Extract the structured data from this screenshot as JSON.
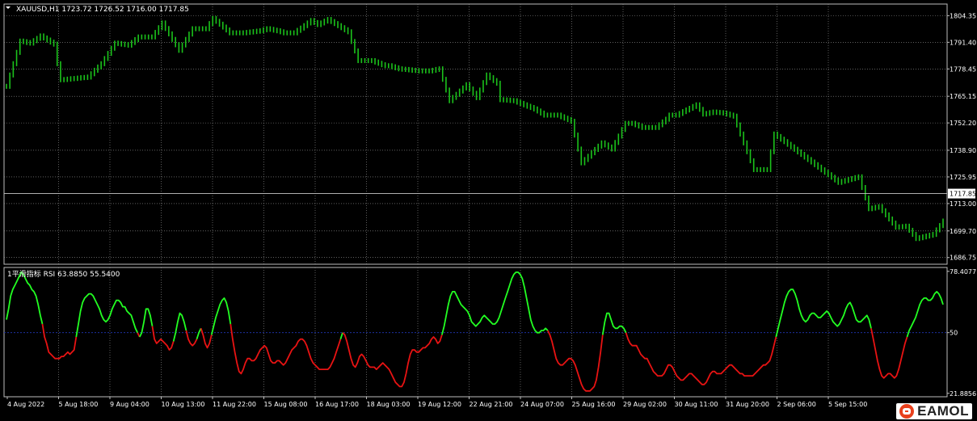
{
  "colors": {
    "background": "#000000",
    "grid": "#9a9a9a",
    "price_bars": "#1bc21b",
    "rsi_up": "#22ff22",
    "rsi_down": "#e81313",
    "rsi_level": "#1c2f9e",
    "current_price_line": "#c8c8c8",
    "text": "#ffffff"
  },
  "chart_data": [
    {
      "type": "candlestick",
      "title": "XAUUSD,H1  1723.72 1726.52 1716.00 1717.85",
      "y_axis_ticks": [
        "1804.35",
        "1791.40",
        "1778.45",
        "1765.15",
        "1752.20",
        "1738.90",
        "1725.95",
        "1713.00",
        "1699.70",
        "1686.75"
      ],
      "ylim": [
        1683.5,
        1810
      ],
      "current_price": 1717.85,
      "current_price_label": "1717.85",
      "grid": true,
      "x": [
        0,
        1,
        2,
        3,
        4,
        5,
        6,
        7,
        8,
        9,
        10,
        11,
        12,
        13,
        14,
        15,
        16,
        17,
        18,
        19,
        20,
        21,
        22,
        23,
        24,
        25,
        26,
        27,
        28,
        29,
        30,
        31,
        32,
        33,
        34,
        35,
        36,
        37,
        38,
        39,
        40,
        41,
        42,
        43,
        44,
        45,
        46,
        47,
        48,
        49,
        50,
        51,
        52,
        53,
        54,
        55,
        56,
        57,
        58,
        59,
        60,
        61,
        62,
        63,
        64,
        65,
        66,
        67,
        68,
        69,
        70,
        71,
        72,
        73,
        74,
        75,
        76,
        77,
        78,
        79,
        80,
        81,
        82,
        83,
        84,
        85,
        86,
        87,
        88,
        89,
        90,
        91,
        92,
        93,
        94,
        95,
        96,
        97,
        98,
        99,
        100,
        101,
        102,
        103,
        104,
        105,
        106,
        107,
        108,
        109,
        110,
        111,
        112,
        113,
        114,
        115,
        116,
        117,
        118,
        119,
        120,
        121,
        122,
        123,
        124,
        125,
        126,
        127,
        128,
        129,
        130,
        131,
        132,
        133,
        134,
        135,
        136,
        137,
        138,
        139,
        140,
        141,
        142,
        143,
        144,
        145,
        146,
        147,
        148,
        149,
        150,
        151,
        152,
        153,
        154,
        155,
        156,
        157,
        158,
        159,
        160,
        161,
        162,
        163,
        164,
        165,
        166,
        167,
        168,
        169,
        170,
        171,
        172,
        173,
        174,
        175,
        176,
        177,
        178,
        179,
        180,
        181,
        182,
        183,
        184,
        185,
        186,
        187,
        188,
        189,
        190,
        191,
        192,
        193,
        194,
        195,
        196,
        197,
        198,
        199,
        200,
        201,
        202,
        203,
        204,
        205,
        206,
        207,
        208,
        209,
        210,
        211,
        212,
        213,
        214,
        215,
        216,
        217,
        218,
        219,
        220,
        221,
        222,
        223,
        224,
        225,
        226,
        227,
        228,
        229,
        230,
        231,
        232,
        233,
        234,
        235,
        236,
        237,
        238,
        239,
        240,
        241,
        242,
        243,
        244,
        245,
        246,
        247,
        248,
        249,
        250,
        251,
        252,
        253,
        254,
        255,
        256,
        257,
        258,
        259,
        260,
        261,
        262,
        263,
        264,
        265,
        266,
        267,
        268,
        269,
        270,
        271,
        272,
        273,
        274,
        275,
        276,
        277,
        278,
        279,
        280,
        281,
        282,
        283,
        284,
        285,
        286,
        287,
        288,
        289,
        290
      ],
      "close": [
        1770,
        1775.5,
        1781,
        1786.5,
        1792,
        1791.7,
        1791.3,
        1791,
        1792.2,
        1793.3,
        1794.5,
        1793.5,
        1792.5,
        1791.5,
        1790.5,
        1781,
        1773.2,
        1773.3,
        1773.5,
        1773.7,
        1773.8,
        1774,
        1774.2,
        1774.3,
        1774.5,
        1776.1,
        1777.8,
        1779.4,
        1781,
        1783.5,
        1786,
        1788.5,
        1791,
        1790.8,
        1790.5,
        1790.3,
        1790,
        1791.3,
        1792.7,
        1794,
        1794,
        1794,
        1794,
        1794,
        1796.2,
        1798.5,
        1800.8,
        1798.1,
        1795.5,
        1792.8,
        1790.2,
        1787.5,
        1790.1,
        1792.8,
        1795.4,
        1798,
        1798,
        1798,
        1798,
        1798,
        1800.5,
        1803,
        1801.6,
        1800.2,
        1798.8,
        1797.4,
        1796,
        1796,
        1796,
        1796,
        1796,
        1796.2,
        1796.4,
        1796.6,
        1796.8,
        1797,
        1797.5,
        1798,
        1797.7,
        1797.3,
        1797,
        1796.5,
        1796,
        1796,
        1796,
        1796,
        1797.2,
        1798.3,
        1799.5,
        1800.8,
        1802,
        1801,
        1800,
        1800.8,
        1801.7,
        1802.5,
        1801.5,
        1800.5,
        1799.5,
        1798.5,
        1797.5,
        1796.5,
        1791.8,
        1787.2,
        1782.5,
        1782.5,
        1782.5,
        1782.5,
        1782.5,
        1781.8,
        1781.2,
        1780.5,
        1780,
        1780,
        1779.5,
        1779,
        1778.5,
        1778.3,
        1778.2,
        1778,
        1777.8,
        1777.7,
        1777.5,
        1777.5,
        1777.5,
        1777.5,
        1777.8,
        1778.2,
        1778.5,
        1773.4,
        1768.2,
        1763,
        1764.6,
        1766.1,
        1767.7,
        1769.2,
        1770.8,
        1768.7,
        1766.6,
        1764.5,
        1768.2,
        1771.8,
        1775.5,
        1774.2,
        1772.8,
        1771.5,
        1763.5,
        1763.4,
        1763.3,
        1763.1,
        1763,
        1762.3,
        1761.7,
        1761,
        1760.3,
        1759.7,
        1759,
        1758,
        1757,
        1756,
        1756,
        1756,
        1756,
        1756,
        1755.2,
        1754.5,
        1753.8,
        1753,
        1746.3,
        1739.5,
        1732.8,
        1734.4,
        1736,
        1737.7,
        1739.3,
        1740.9,
        1742.5,
        1741.5,
        1740.5,
        1739.5,
        1742.7,
        1745.8,
        1749,
        1752,
        1752,
        1752,
        1751.3,
        1750.7,
        1750,
        1750,
        1750,
        1750,
        1750,
        1751.3,
        1752.7,
        1754,
        1756,
        1756,
        1756,
        1756.8,
        1757.7,
        1758.5,
        1759.3,
        1760.2,
        1761,
        1758.8,
        1756.5,
        1756.8,
        1757.2,
        1757.5,
        1757.3,
        1757.2,
        1757,
        1756.5,
        1756,
        1755.5,
        1751.2,
        1746.8,
        1742.5,
        1738.2,
        1733.8,
        1729.5,
        1729.5,
        1729.5,
        1729.5,
        1729.5,
        1738.2,
        1746.8,
        1745.6,
        1744.3,
        1743.1,
        1741.8,
        1740.6,
        1739.4,
        1738.1,
        1736.9,
        1735.6,
        1734.4,
        1733.2,
        1731.9,
        1730.7,
        1729.4,
        1728.2,
        1727,
        1725.8,
        1724.5,
        1723.3,
        1723.8,
        1724.2,
        1724.7,
        1725.1,
        1725.6,
        1726,
        1720.8,
        1715.7,
        1710.5,
        1710.8,
        1711.2,
        1711.5,
        1709.5,
        1707.5,
        1705.5,
        1703.5,
        1701.5,
        1701.7,
        1701.8,
        1702,
        1700,
        1698,
        1696,
        1696.4,
        1696.8,
        1697.2,
        1697.6,
        1698,
        1700.2,
        1702.3,
        1704.5
      ],
      "x_axis_ticks": [
        "4 Aug 2022",
        "5 Aug 18:00",
        "9 Aug 04:00",
        "10 Aug 13:00",
        "11 Aug 22:00",
        "15 Aug 08:00",
        "16 Aug 17:00",
        "18 Aug 03:00",
        "19 Aug 12:00",
        "22 Aug 21:00",
        "24 Aug 07:00",
        "25 Aug 16:00",
        "29 Aug 02:00",
        "30 Aug 11:00",
        "31 Aug 20:00",
        "2 Sep 06:00",
        "5 Sep 15:00"
      ],
      "note": "close-only approximation of hourly bars; last bar close 1717.85"
    },
    {
      "type": "line",
      "title": "1平滑指标 RSI 63.8850 55.5400",
      "y_axis_ticks": [
        "78.4077",
        "50",
        "21.8856"
      ],
      "ylim": [
        20.3,
        80.2
      ],
      "level": 50,
      "grid": true,
      "series": [
        {
          "values": [
            56,
            61,
            67,
            70,
            72,
            74,
            76,
            78,
            77,
            75,
            73,
            72,
            70,
            69,
            67,
            63,
            58,
            54,
            48,
            45,
            41,
            40,
            39,
            38,
            38,
            38,
            39,
            39,
            40,
            41,
            40,
            41,
            42,
            48,
            54,
            60,
            64,
            66,
            67,
            68,
            68,
            67,
            65,
            63,
            61,
            58,
            56,
            55,
            56,
            58,
            61,
            63,
            65,
            65,
            64,
            62,
            62,
            60,
            59,
            58,
            55,
            52,
            50,
            48,
            50,
            55,
            61,
            61,
            58,
            53,
            47,
            45,
            46,
            47,
            46,
            45,
            44,
            42,
            43,
            46,
            50,
            55,
            59,
            58,
            55,
            51,
            47,
            45,
            44,
            45,
            47,
            50,
            52,
            49,
            45,
            43,
            45,
            49,
            53,
            57,
            60,
            63,
            65,
            66,
            64,
            60,
            54,
            47,
            41,
            36,
            32,
            31,
            33,
            36,
            38,
            38,
            37,
            37,
            38,
            40,
            42,
            43,
            44,
            43,
            40,
            37,
            36,
            36,
            37,
            37,
            36,
            35,
            36,
            38,
            40,
            42,
            43,
            44,
            46,
            47,
            47,
            46,
            44,
            41,
            38,
            36,
            35,
            34,
            33,
            33,
            33,
            33,
            33,
            34,
            36,
            38,
            41,
            44,
            47,
            50,
            49,
            46,
            42,
            38,
            35,
            34,
            36,
            39,
            40,
            39,
            37,
            35,
            34,
            34,
            34,
            33,
            34,
            35,
            36,
            35,
            34,
            33,
            31,
            29,
            27,
            26,
            25,
            25,
            27,
            31,
            36,
            40,
            42,
            42,
            41,
            41,
            42,
            43,
            43,
            44,
            45,
            47,
            48,
            47,
            45,
            46,
            49,
            53,
            58,
            63,
            67,
            69,
            69,
            67,
            65,
            63,
            62,
            61,
            60,
            58,
            55,
            54,
            53,
            54,
            55,
            57,
            58,
            57,
            56,
            55,
            54,
            54,
            55,
            57,
            60,
            63,
            66,
            69,
            72,
            75,
            77,
            78,
            78,
            77,
            75,
            71,
            66,
            61,
            56,
            53,
            51,
            50,
            50,
            51,
            51,
            52,
            51,
            49,
            46,
            42,
            38,
            36,
            35,
            35,
            36,
            37,
            38,
            38,
            37,
            35,
            32,
            29,
            26,
            24,
            23,
            23,
            23,
            24,
            25,
            28,
            34,
            41,
            49,
            55,
            59,
            59,
            56,
            53,
            52,
            52,
            53,
            53,
            52,
            50,
            47,
            45,
            44,
            44,
            44,
            42,
            40,
            39,
            38,
            38,
            36,
            34,
            32,
            31,
            30,
            30,
            30,
            31,
            33,
            35,
            35,
            34,
            32,
            30,
            29,
            28,
            28,
            29,
            30,
            31,
            31,
            30,
            29,
            28,
            27,
            26,
            26,
            27,
            29,
            31,
            32,
            32,
            31,
            31,
            31,
            32,
            33,
            34,
            35,
            35,
            34,
            33,
            32,
            31,
            31,
            30,
            30,
            30,
            30,
            30,
            31,
            32,
            33,
            34,
            35,
            35,
            36,
            37,
            40,
            44,
            48,
            52,
            56,
            60,
            64,
            67,
            69,
            70,
            70,
            68,
            65,
            61,
            58,
            56,
            55,
            56,
            58,
            59,
            59,
            58,
            57,
            57,
            58,
            59,
            60,
            59,
            57,
            55,
            54,
            53,
            54,
            56,
            58,
            61,
            63,
            64,
            62,
            59,
            56,
            55,
            55,
            56,
            57,
            58,
            56,
            52,
            47,
            42,
            37,
            33,
            30,
            29,
            30,
            31,
            31,
            30,
            29,
            30,
            33,
            37,
            41,
            45,
            48,
            51,
            53,
            55,
            57,
            60,
            63,
            65,
            66,
            66,
            65,
            65,
            66,
            68,
            69,
            68,
            66,
            63
          ]
        }
      ],
      "note": "segments coloured green when RSI rising and red when falling"
    }
  ],
  "branding": {
    "name": "EAMOL"
  }
}
